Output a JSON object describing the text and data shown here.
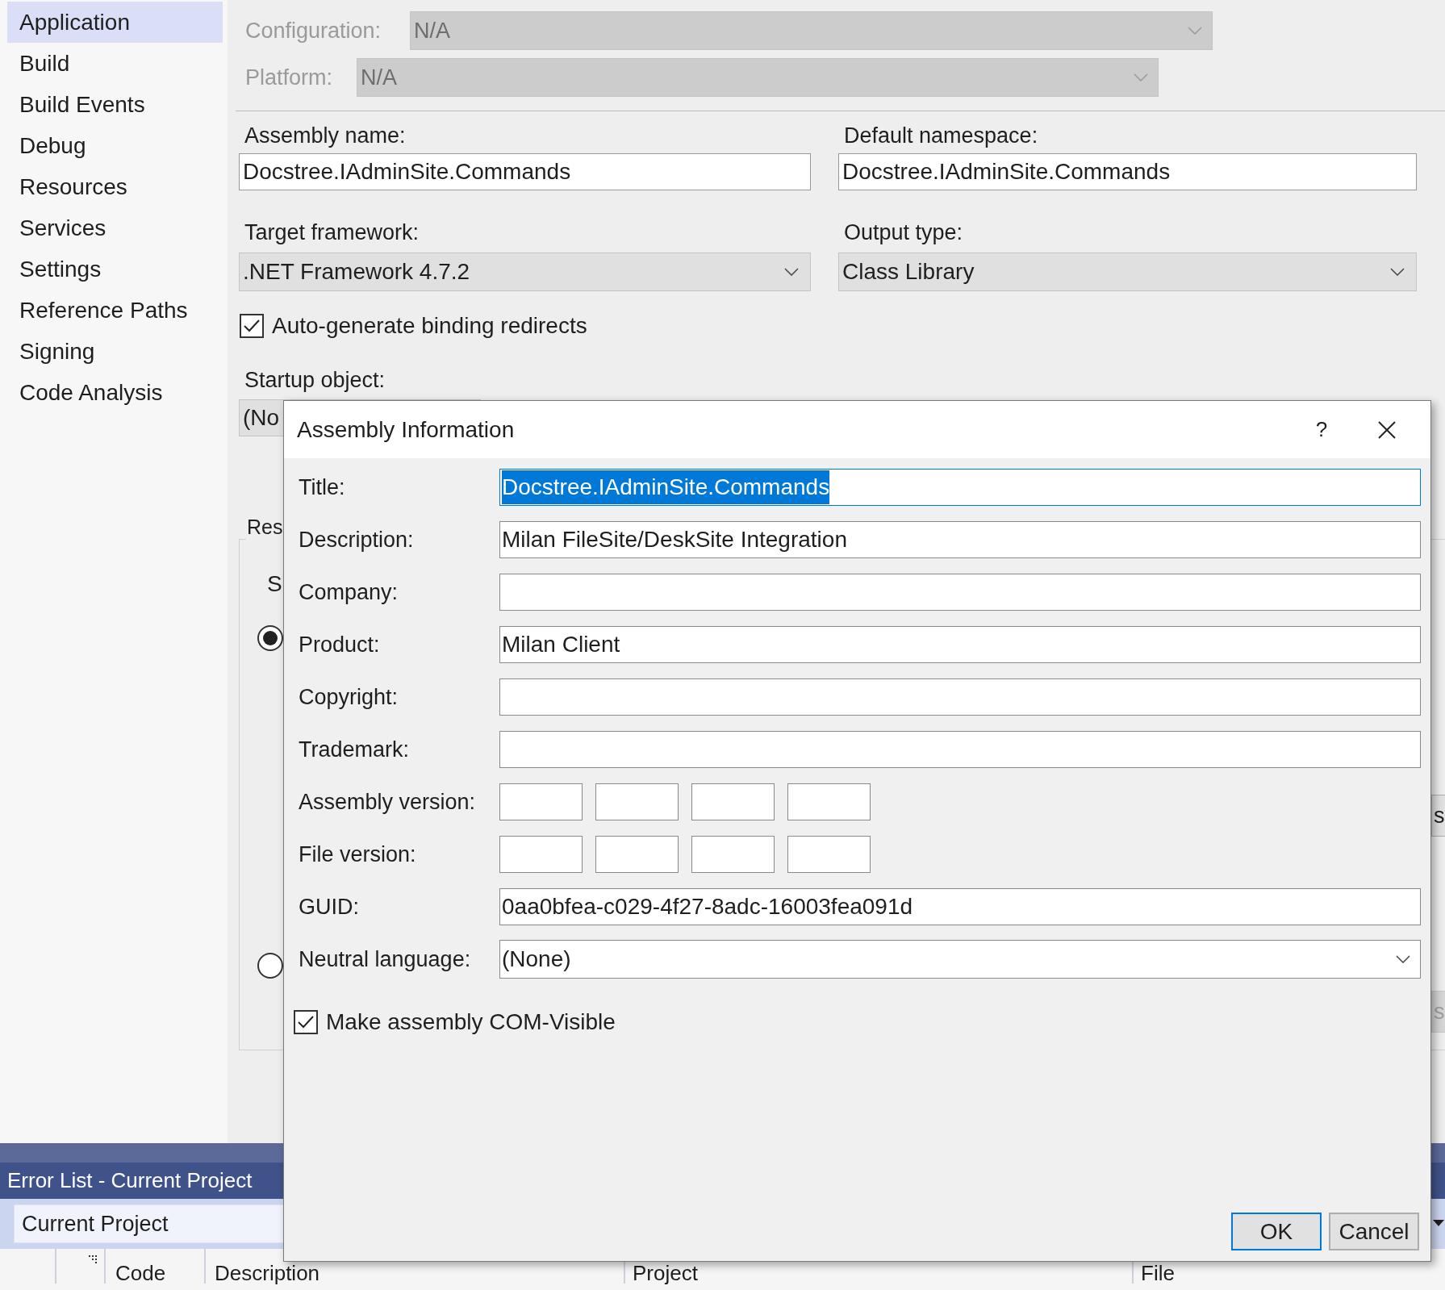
{
  "sidebar": {
    "items": [
      {
        "label": "Application",
        "selected": true
      },
      {
        "label": "Build",
        "selected": false
      },
      {
        "label": "Build Events",
        "selected": false
      },
      {
        "label": "Debug",
        "selected": false
      },
      {
        "label": "Resources",
        "selected": false
      },
      {
        "label": "Services",
        "selected": false
      },
      {
        "label": "Settings",
        "selected": false
      },
      {
        "label": "Reference Paths",
        "selected": false
      },
      {
        "label": "Signing",
        "selected": false
      },
      {
        "label": "Code Analysis",
        "selected": false
      }
    ]
  },
  "config": {
    "configuration_label": "Configuration:",
    "configuration_value": "N/A",
    "platform_label": "Platform:",
    "platform_value": "N/A",
    "disabled": true
  },
  "assembly_name": {
    "label": "Assembly name:",
    "value": "Docstree.IAdminSite.Commands"
  },
  "default_namespace": {
    "label": "Default namespace:",
    "value": "Docstree.IAdminSite.Commands"
  },
  "target_framework": {
    "label": "Target framework:",
    "value": ".NET Framework 4.7.2"
  },
  "output_type": {
    "label": "Output type:",
    "value": "Class Library"
  },
  "binding_redirects": {
    "label": "Auto-generate binding redirects",
    "checked": true
  },
  "startup_object": {
    "label": "Startup object:",
    "value": "(No"
  },
  "resources": {
    "label": "Res",
    "option_label": "S",
    "radios": [
      {
        "selected": true
      },
      {
        "selected": false
      }
    ],
    "side_buttons": [
      {
        "label": "s",
        "disabled": false
      },
      {
        "label": "s",
        "disabled": true
      }
    ]
  },
  "dialog": {
    "title": "Assembly Information",
    "help": "?",
    "fields": [
      {
        "kind": "text",
        "label": "Title:",
        "value": "Docstree.IAdminSite.Commands",
        "selected": true
      },
      {
        "kind": "text",
        "label": "Description:",
        "value": "Milan FileSite/DeskSite Integration",
        "selected": false
      },
      {
        "kind": "text",
        "label": "Company:",
        "selected": false
      },
      {
        "kind": "text",
        "label": "Product:",
        "value": "Milan Client",
        "selected": false
      },
      {
        "kind": "text",
        "label": "Copyright:",
        "selected": false
      },
      {
        "kind": "text",
        "label": "Trademark:",
        "selected": false
      },
      {
        "kind": "version",
        "label": "Assembly version:"
      },
      {
        "kind": "version",
        "label": "File version:"
      },
      {
        "kind": "text",
        "label": "GUID:",
        "value": "0aa0bfea-c029-4f27-8adc-16003fea091d",
        "selected": false
      },
      {
        "kind": "dropdown",
        "label": "Neutral language:",
        "value": "(None)"
      }
    ],
    "com_visible": {
      "label": "Make assembly COM-Visible",
      "checked": true
    },
    "buttons": [
      {
        "label": "OK",
        "default": true
      },
      {
        "label": "Cancel",
        "default": false
      }
    ]
  },
  "error_list": {
    "title": "Error List - Current Project",
    "filter": "Current Project",
    "columns": [
      "Code",
      "Description",
      "Project",
      "File"
    ]
  }
}
